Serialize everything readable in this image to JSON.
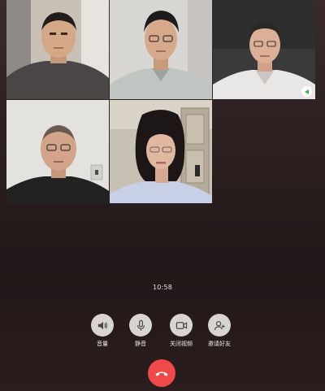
{
  "call": {
    "duration": "10:58"
  },
  "participants": [
    {
      "id": "p1",
      "active_speaker": false
    },
    {
      "id": "p2",
      "active_speaker": false
    },
    {
      "id": "p3",
      "active_speaker": true
    },
    {
      "id": "p4",
      "active_speaker": false
    },
    {
      "id": "p5",
      "active_speaker": false
    }
  ],
  "controls": {
    "speaker_label": "音量",
    "mute_label": "静音",
    "camera_label": "关闭视频",
    "invite_label": "邀请好友",
    "speaker_icon": "speaker-icon",
    "mute_icon": "microphone-icon",
    "camera_icon": "video-camera-icon",
    "invite_icon": "add-person-icon",
    "hangup_icon": "phone-hangup-icon"
  },
  "colors": {
    "background": "#2b1f20",
    "control_button": "#d9d4d4",
    "hangup": "#f0494a",
    "speaking_indicator": "#3bb54a"
  }
}
